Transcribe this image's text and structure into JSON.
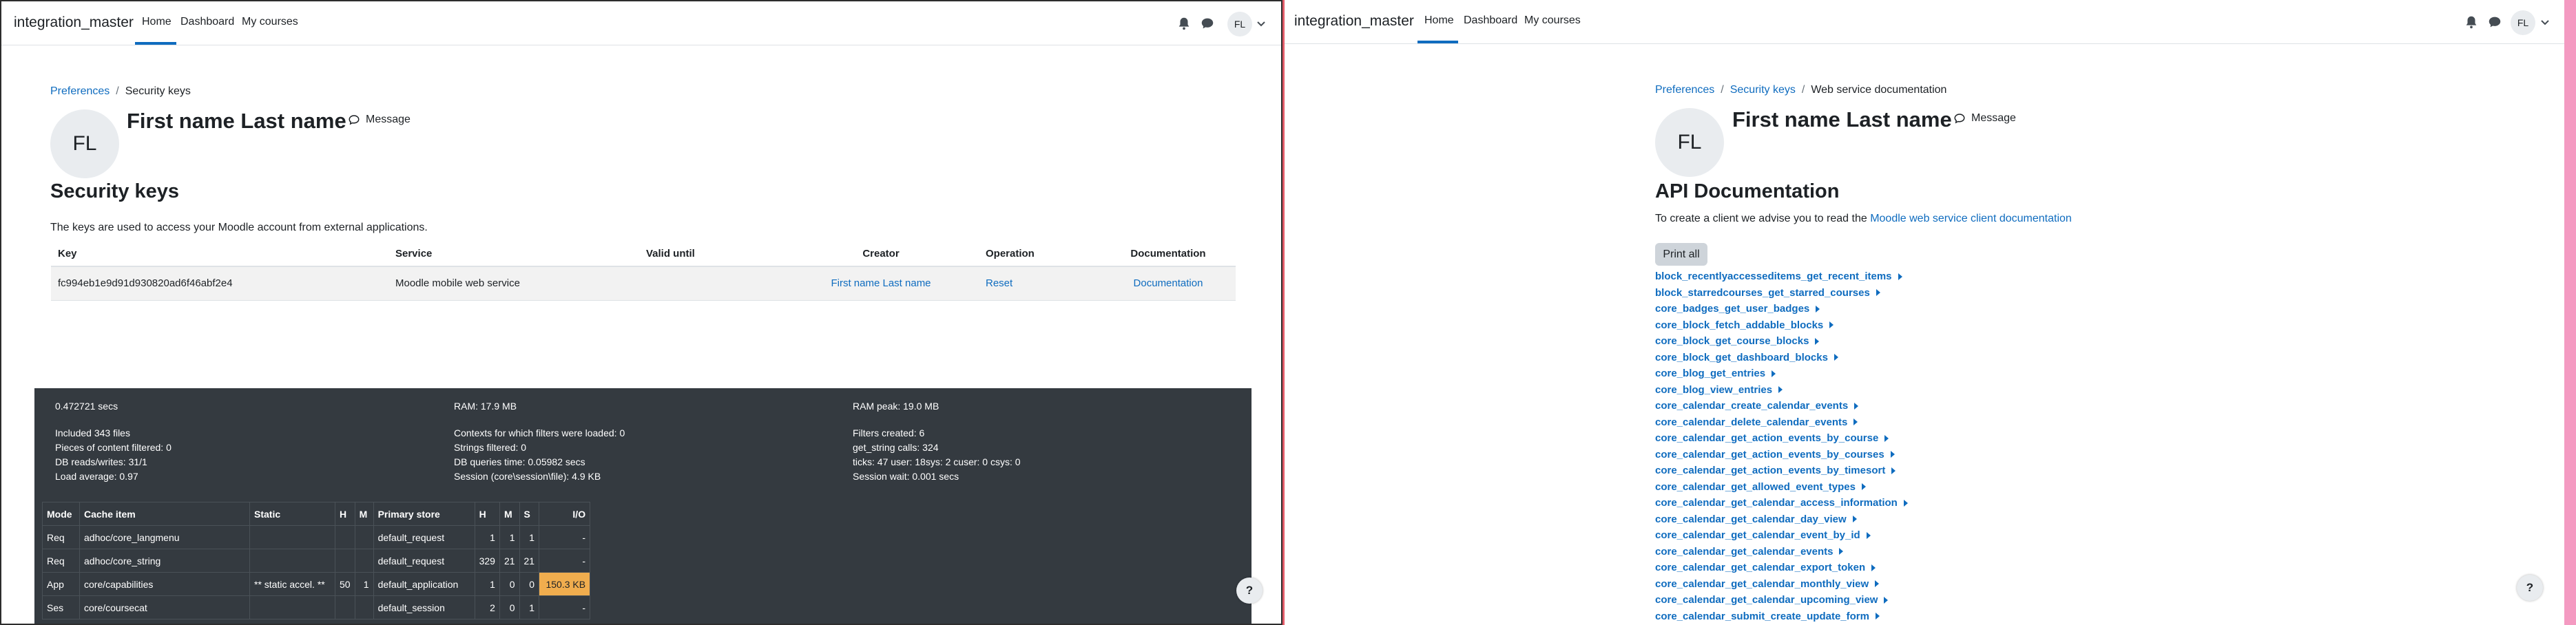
{
  "left": {
    "navbar": {
      "brand": "integration_master",
      "links": [
        "Home",
        "Dashboard",
        "My courses"
      ],
      "user_initials": "FL"
    },
    "breadcrumb": {
      "parent": "Preferences",
      "current": "Security keys"
    },
    "profile": {
      "initials": "FL",
      "name": "First name Last name",
      "message_label": "Message"
    },
    "title": "Security keys",
    "intro": "The keys are used to access your Moodle account from external applications.",
    "keys_table": {
      "headers": [
        "Key",
        "Service",
        "Valid until",
        "Creator",
        "Operation",
        "Documentation"
      ],
      "rows": [
        {
          "key": "fc994eb1e9d91d930820ad6f46abf2e4",
          "service": "Moodle mobile web service",
          "valid_until": "",
          "creator": "First name Last name",
          "operation": "Reset",
          "documentation": "Documentation"
        }
      ]
    },
    "perf": {
      "time": "0.472721 secs",
      "ram": "RAM: 17.9 MB",
      "ram_peak": "RAM peak: 19.0 MB",
      "included": "Included 343 files",
      "contexts": "Contexts for which filters were loaded: 0",
      "filters_created": "Filters created: 6",
      "pieces": "Pieces of content filtered: 0",
      "strings": "Strings filtered: 0",
      "get_string": "get_string calls: 324",
      "db_rw": "DB reads/writes: 31/1",
      "db_time": "DB queries time: 0.05982 secs",
      "ticks": "ticks: 47 user: 18sys: 2 cuser: 0 csys: 0",
      "load": "Load average: 0.97",
      "session": "Session (core\\session\\file): 4.9 KB",
      "session_wait": "Session wait: 0.001 secs"
    },
    "cache_table": {
      "headers": [
        "Mode",
        "Cache item",
        "Static",
        "H",
        "M",
        "Primary store",
        "H",
        "M",
        "S",
        "I/O"
      ],
      "rows": [
        [
          "Req",
          "adhoc/core_langmenu",
          "",
          "",
          "",
          "default_request",
          "1",
          "1",
          "1",
          "-"
        ],
        [
          "Req",
          "adhoc/core_string",
          "",
          "",
          "",
          "default_request",
          "329",
          "21",
          "21",
          "-"
        ],
        [
          "App",
          "core/capabilities",
          "** static accel. **",
          "50",
          "1",
          "default_application",
          "1",
          "0",
          "0",
          "150.3 KB"
        ],
        [
          "Ses",
          "core/coursecat",
          "",
          "",
          "",
          "default_session",
          "2",
          "0",
          "1",
          "-"
        ]
      ]
    },
    "help": "?"
  },
  "right": {
    "navbar": {
      "brand": "integration_master",
      "links": [
        "Home",
        "Dashboard",
        "My courses"
      ],
      "user_initials": "FL"
    },
    "breadcrumb": {
      "first": "Preferences",
      "second": "Security keys",
      "current": "Web service documentation"
    },
    "profile": {
      "initials": "FL",
      "name": "First name Last name",
      "message_label": "Message"
    },
    "title": "API Documentation",
    "intro_text": "To create a client we advise you to read the ",
    "intro_link": "Moodle web service client documentation",
    "print_all": "Print all",
    "functions": [
      "block_recentlyaccesseditems_get_recent_items",
      "block_starredcourses_get_starred_courses",
      "core_badges_get_user_badges",
      "core_block_fetch_addable_blocks",
      "core_block_get_course_blocks",
      "core_block_get_dashboard_blocks",
      "core_blog_get_entries",
      "core_blog_view_entries",
      "core_calendar_create_calendar_events",
      "core_calendar_delete_calendar_events",
      "core_calendar_get_action_events_by_course",
      "core_calendar_get_action_events_by_courses",
      "core_calendar_get_action_events_by_timesort",
      "core_calendar_get_allowed_event_types",
      "core_calendar_get_calendar_access_information",
      "core_calendar_get_calendar_day_view",
      "core_calendar_get_calendar_event_by_id",
      "core_calendar_get_calendar_events",
      "core_calendar_get_calendar_export_token",
      "core_calendar_get_calendar_monthly_view",
      "core_calendar_get_calendar_upcoming_view",
      "core_calendar_submit_create_update_form"
    ],
    "help": "?"
  },
  "colors": {
    "link": "#0f6cbf",
    "footer_bg": "#343a40",
    "io_highlight": "#f0ad4e",
    "divider": "#e35d6a"
  }
}
